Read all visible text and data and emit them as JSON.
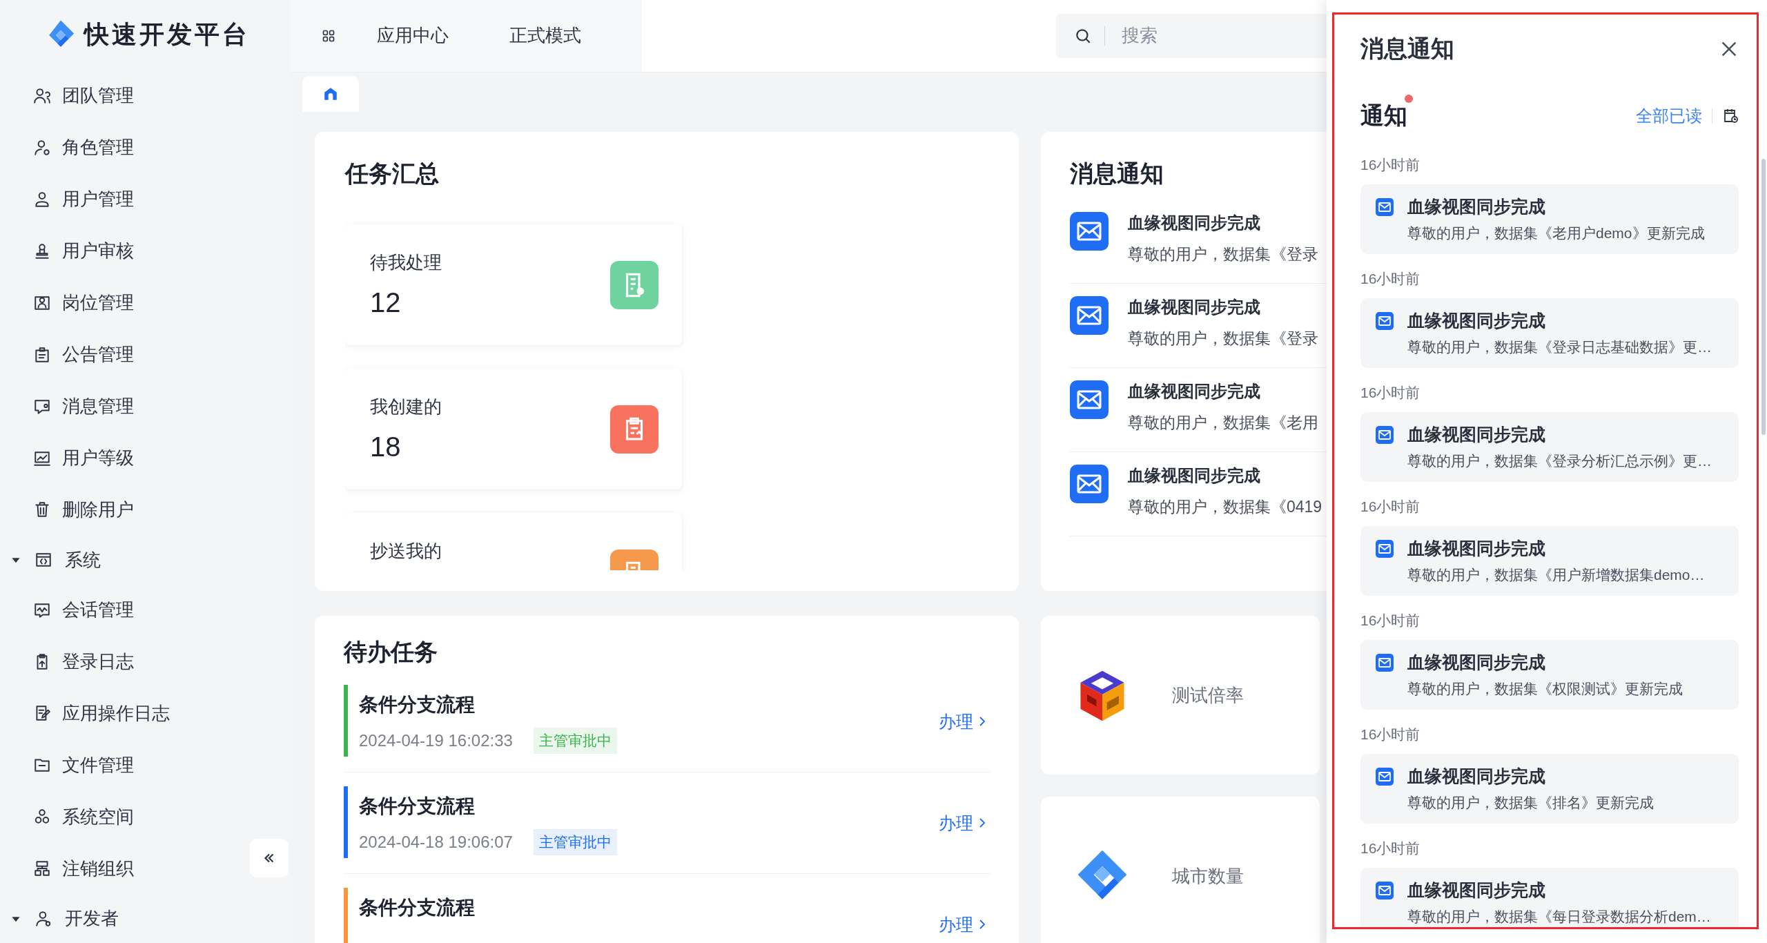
{
  "sidebar": {
    "logo": "快速开发平台",
    "items": [
      {
        "label": "团队管理"
      },
      {
        "label": "角色管理"
      },
      {
        "label": "用户管理"
      },
      {
        "label": "用户审核"
      },
      {
        "label": "岗位管理"
      },
      {
        "label": "公告管理"
      },
      {
        "label": "消息管理"
      },
      {
        "label": "用户等级"
      },
      {
        "label": "删除用户"
      }
    ],
    "groups": [
      {
        "label": "系统",
        "expanded": true,
        "children": [
          {
            "label": "会话管理"
          },
          {
            "label": "登录日志"
          },
          {
            "label": "应用操作日志"
          },
          {
            "label": "文件管理"
          },
          {
            "label": "系统空间"
          },
          {
            "label": "注销组织"
          }
        ]
      },
      {
        "label": "开发者",
        "expanded": true
      }
    ]
  },
  "topbar": {
    "nav": [
      "应用中心",
      "正式模式"
    ],
    "search": {
      "placeholder": "搜索"
    }
  },
  "task_summary": {
    "title": "任务汇总",
    "cards": [
      {
        "label": "待我处理",
        "count": "12",
        "color": "#6fd3a0"
      },
      {
        "label": "我创建的",
        "count": "18",
        "color": "#f8725e"
      },
      {
        "label": "抄送我的",
        "color": "#f5994a"
      }
    ]
  },
  "messages": {
    "title": "消息通知",
    "items": [
      {
        "title": "血缘视图同步完成",
        "text": "尊敬的用户，数据集《登录"
      },
      {
        "title": "血缘视图同步完成",
        "text": "尊敬的用户，数据集《登录"
      },
      {
        "title": "血缘视图同步完成",
        "text": "尊敬的用户，数据集《老用"
      },
      {
        "title": "血缘视图同步完成",
        "text": "尊敬的用户，数据集《0419"
      }
    ]
  },
  "todo": {
    "title": "待办任务",
    "items": [
      {
        "title": "条件分支流程",
        "date": "2024-04-19 16:02:33",
        "status": "主管审批中",
        "color": "#3bb54a",
        "action": "办理"
      },
      {
        "title": "条件分支流程",
        "date": "2024-04-18 19:06:07",
        "status": "主管审批中",
        "color": "#1f6df5",
        "action": "办理"
      },
      {
        "title": "条件分支流程",
        "color": "#f7963c",
        "action": "办理"
      }
    ]
  },
  "apps": [
    {
      "label": "测试倍率"
    },
    {
      "label": "城市数量"
    }
  ],
  "panel": {
    "title": "消息通知",
    "section": "通知",
    "unread": true,
    "mark_all": "全部已读",
    "groups": [
      {
        "time": "16小时前",
        "title": "血缘视图同步完成",
        "text": "尊敬的用户，数据集《老用户demo》更新完成"
      },
      {
        "time": "16小时前",
        "title": "血缘视图同步完成",
        "text": "尊敬的用户，数据集《登录日志基础数据》更…"
      },
      {
        "time": "16小时前",
        "title": "血缘视图同步完成",
        "text": "尊敬的用户，数据集《登录分析汇总示例》更…"
      },
      {
        "time": "16小时前",
        "title": "血缘视图同步完成",
        "text": "尊敬的用户，数据集《用户新增数据集demo…"
      },
      {
        "time": "16小时前",
        "title": "血缘视图同步完成",
        "text": "尊敬的用户，数据集《权限测试》更新完成"
      },
      {
        "time": "16小时前",
        "title": "血缘视图同步完成",
        "text": "尊敬的用户，数据集《排名》更新完成"
      },
      {
        "time": "16小时前",
        "title": "血缘视图同步完成",
        "text": "尊敬的用户，数据集《每日登录数据分析dem…"
      }
    ]
  }
}
